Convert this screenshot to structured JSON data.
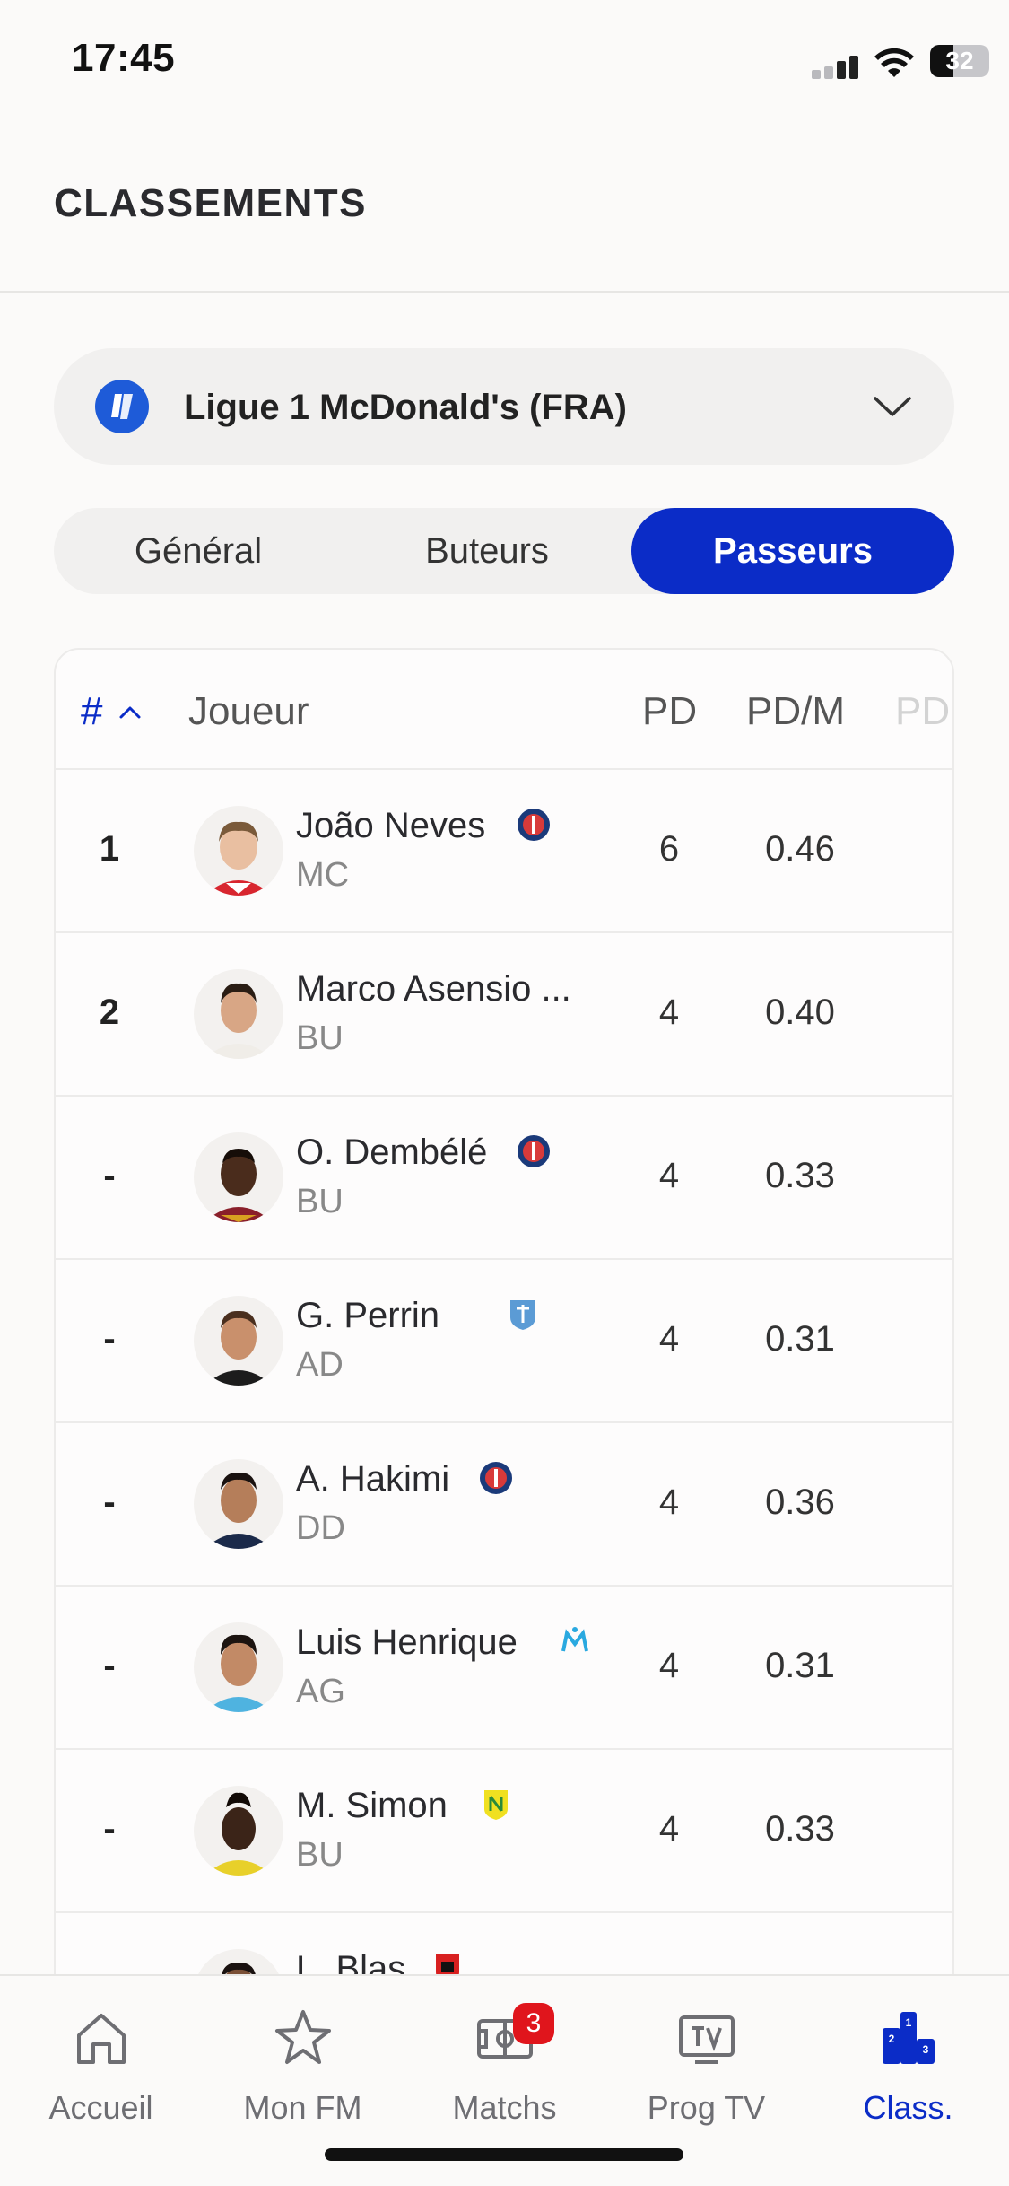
{
  "status_bar": {
    "time": "17:45",
    "battery": "32"
  },
  "header": {
    "title": "CLASSEMENTS"
  },
  "league": {
    "name": "Ligue 1 McDonald's (FRA)",
    "logo_color": "#1e5bd8"
  },
  "tabs": [
    {
      "label": "Général",
      "active": false
    },
    {
      "label": "Buteurs",
      "active": false
    },
    {
      "label": "Passeurs",
      "active": true
    }
  ],
  "table": {
    "headers": {
      "rank": "#",
      "player": "Joueur",
      "pd": "PD",
      "pdm": "PD/M",
      "pd2": "PD"
    },
    "rows": [
      {
        "rank": "1",
        "name": "João Neves",
        "position": "MC",
        "club_icon": "psg-icon",
        "pd": "6",
        "pdm": "0.46"
      },
      {
        "rank": "2",
        "name": "Marco Asensio ...",
        "position": "BU",
        "club_icon": "",
        "pd": "4",
        "pdm": "0.40"
      },
      {
        "rank": "-",
        "name": "O. Dembélé",
        "position": "BU",
        "club_icon": "psg-icon",
        "pd": "4",
        "pdm": "0.33"
      },
      {
        "rank": "-",
        "name": "G. Perrin",
        "position": "AD",
        "club_icon": "auxerre-icon",
        "pd": "4",
        "pdm": "0.31"
      },
      {
        "rank": "-",
        "name": "A. Hakimi",
        "position": "DD",
        "club_icon": "psg-icon",
        "pd": "4",
        "pdm": "0.36"
      },
      {
        "rank": "-",
        "name": "Luis Henrique",
        "position": "AG",
        "club_icon": "om-icon",
        "pd": "4",
        "pdm": "0.31"
      },
      {
        "rank": "-",
        "name": "M. Simon",
        "position": "BU",
        "club_icon": "nantes-icon",
        "pd": "4",
        "pdm": "0.33"
      },
      {
        "rank": "",
        "name": "L. Blas",
        "position": "",
        "club_icon": "rennes-icon",
        "pd": "",
        "pdm": ""
      }
    ]
  },
  "nav": {
    "items": [
      {
        "label": "Accueil",
        "icon": "home-icon"
      },
      {
        "label": "Mon FM",
        "icon": "star-icon"
      },
      {
        "label": "Matchs",
        "icon": "pitch-icon",
        "badge": "3"
      },
      {
        "label": "Prog TV",
        "icon": "tv-icon"
      },
      {
        "label": "Class.",
        "icon": "podium-icon",
        "active": true
      }
    ]
  },
  "colors": {
    "accent": "#0b2cc7",
    "badge": "#e0151c"
  }
}
